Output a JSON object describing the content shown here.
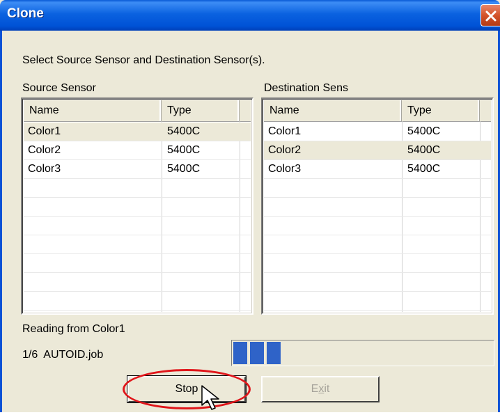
{
  "window": {
    "title": "Clone"
  },
  "instruction": "Select Source Sensor and Destination Sensor(s).",
  "source": {
    "label": "Source Sensor",
    "columns": [
      "Name",
      "Type"
    ],
    "rows": [
      {
        "name": "Color1",
        "type": "5400C",
        "selected": true
      },
      {
        "name": "Color2",
        "type": "5400C",
        "selected": false
      },
      {
        "name": "Color3",
        "type": "5400C",
        "selected": false
      }
    ]
  },
  "destination": {
    "label": "Destination Sens",
    "columns": [
      "Name",
      "Type"
    ],
    "rows": [
      {
        "name": "Color1",
        "type": "5400C",
        "selected": false
      },
      {
        "name": "Color2",
        "type": "5400C",
        "selected": true
      },
      {
        "name": "Color3",
        "type": "5400C",
        "selected": false
      }
    ]
  },
  "status": {
    "reading": "Reading from Color1",
    "job_count": "1/6",
    "job_file": "AUTOID.job",
    "progress_chunks": 3
  },
  "buttons": {
    "stop_prefix": "",
    "stop_mnemonic": "S",
    "stop_rest": "top",
    "exit_prefix": "E",
    "exit_mnemonic": "x",
    "exit_rest": "it"
  },
  "colors": {
    "titlebar": "#0b62e0",
    "progress": "#2f63c8",
    "highlight": "#e0151a",
    "face": "#ece9d8"
  },
  "icons": {
    "close": "close-icon",
    "cursor": "mouse-pointer-icon"
  }
}
